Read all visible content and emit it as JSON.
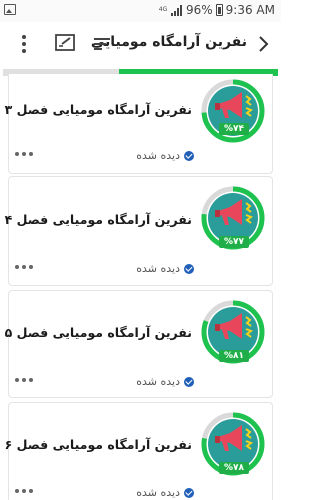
{
  "status_bar": {
    "network": "4G",
    "battery": "96%",
    "time": "9:36 AM",
    "icons": [
      "gallery-icon",
      "signal-icon",
      "battery-icon"
    ]
  },
  "app_bar": {
    "title": "نفرین آرامگاه مومیایی",
    "icons": [
      "back-chevron-icon",
      "sort-icon",
      "note-edit-icon",
      "more-vert-icon"
    ]
  },
  "progress": {
    "value": 0.58,
    "color": "#1ec24f"
  },
  "episodes": [
    {
      "title": "نفرین آرامگاه مومیایی فصل ۳",
      "progress_label": "%۷۴",
      "progress": 0.74,
      "status": "دیده شده"
    },
    {
      "title": "نفرین آرامگاه مومیایی فصل ۴",
      "progress_label": "%۷۷",
      "progress": 0.77,
      "status": "دیده شده"
    },
    {
      "title": "نفرین آرامگاه مومیایی فصل ۵",
      "progress_label": "%۸۱",
      "progress": 0.81,
      "status": "دیده شده"
    },
    {
      "title": "نفرین آرامگاه مومیایی فصل ۶",
      "progress_label": "%۷۸",
      "progress": 0.78,
      "status": "دیده شده"
    }
  ],
  "colors": {
    "accent": "#1ec24f",
    "ring_bg": "#d9d9d9",
    "megaphone": "#e8465b",
    "check": "#1f5fb8"
  }
}
